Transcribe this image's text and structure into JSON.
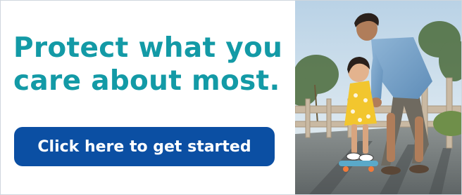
{
  "banner": {
    "headline_line1": "Protect what you",
    "headline_line2": "care about most.",
    "cta_label": "Click here to get started",
    "photo_alt": "Father helping young daughter ride a skateboard on a sunny boardwalk"
  },
  "colors": {
    "headline": "#139aa6",
    "cta_background": "#0b4fa3",
    "cta_text": "#ffffff",
    "border": "#cfd6de"
  }
}
